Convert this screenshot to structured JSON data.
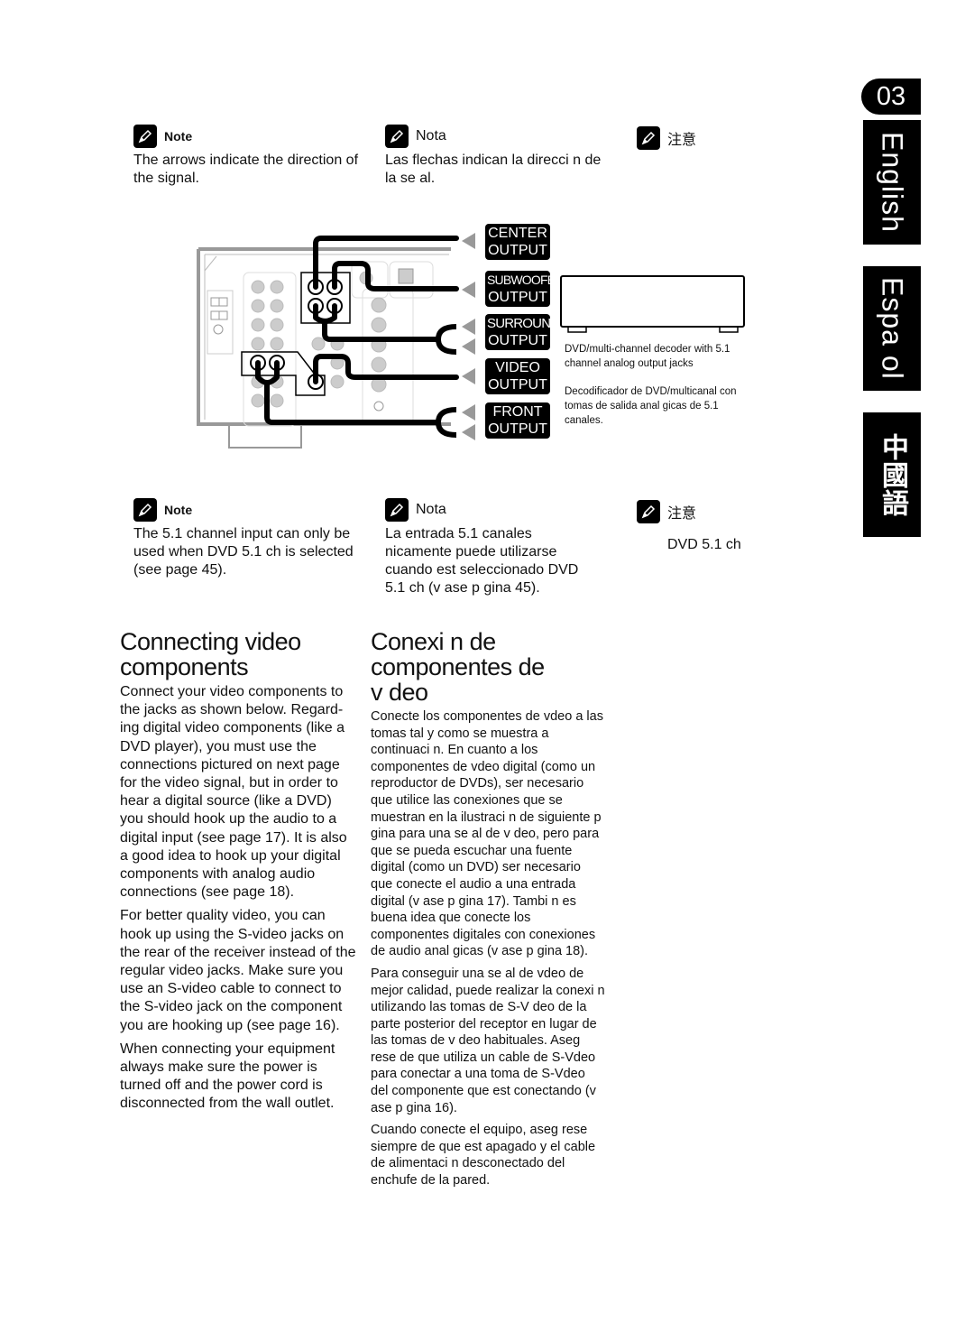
{
  "chapter": "03",
  "language_tabs": [
    {
      "label": "English"
    },
    {
      "label": "Espa ol"
    },
    {
      "label": "中國語"
    }
  ],
  "note_top": {
    "en": {
      "title": "Note",
      "text": "The arrows indicate the direction of the signal."
    },
    "es": {
      "title": "Nota",
      "text": "Las flechas indican la direcci n de la se al."
    },
    "zh": {
      "title": "注意",
      "text": ""
    }
  },
  "diagram": {
    "outputs": [
      {
        "line1": "CENTER",
        "line2": "OUTPUT"
      },
      {
        "line1": "SUBWOOFER",
        "line2": "OUTPUT"
      },
      {
        "line1": "SURROUND",
        "line2": "OUTPUT"
      },
      {
        "line1": "VIDEO",
        "line2": "OUTPUT"
      },
      {
        "line1": "FRONT",
        "line2": "OUTPUT"
      }
    ],
    "device_caption_en": "DVD/multi-channel decoder with 5.1 channel analog output jacks",
    "device_caption_es": "Decodificador de DVD/multicanal con tomas de salida anal   gicas de 5.1 canales."
  },
  "note_bottom": {
    "en": {
      "title": "Note",
      "text": "The 5.1 channel input can only be used when DVD 5.1 ch is selected (see page 45)."
    },
    "es": {
      "title": "Nota",
      "text": "La entrada 5.1 canales  nicamente puede utilizarse cuando est   seleccionado DVD 5.1 ch (v ase p gina 45)."
    },
    "zh": {
      "title": "注意",
      "text": "DVD 5.1 ch"
    }
  },
  "section_en": {
    "heading": "Connecting video components",
    "paragraphs": [
      "Connect your video components to the jacks as shown below. Regard-ing digital video components (like a DVD player), you must use the connections pictured on next page for the video signal, but in order to hear a digital source (like a DVD) you should hook up the audio to a digital input (see page 17). It is also a good idea to hook up your digital components with analog audio connections (see page 18).",
      "For better quality video, you can hook up using the S-video jacks on the rear of the receiver instead of the regular video jacks. Make sure you use an S-video cable to connect to the S-video jack on the component you are hooking up (see page 16).",
      "When connecting your equipment always make sure the power is turned off and the power cord is disconnected from the wall outlet."
    ]
  },
  "section_es": {
    "heading": "Conexi    n de componentes de v deo",
    "paragraphs": [
      "Conecte los componentes de vdeo a las tomas tal y como se muestra a continuaci  n. En cuanto a los componentes de vdeo digital (como un reproductor de DVDs), ser necesario que utilice las conexiones que se muestran en la ilustraci  n de siguiente p  gina para una se  al de v deo, pero para que se pueda escuchar una fuente digital (como un DVD) ser  necesario que conecte el audio a una entrada digital (v ase p  gina 17). Tambi n es buena idea que conecte los componentes digitales con conexiones de audio anal  gicas (v  ase p gina 18).",
      "Para conseguir una se al de vdeo de mejor calidad, puede realizar la conexi  n utilizando las tomas de S-V deo de la parte posterior del receptor en lugar de las tomas de v deo habituales. Aseg rese de que utiliza un cable de S-Vdeo para conectar a una toma de S-Vdeo del componente que est  conectando (v  ase p gina 16).",
      "Cuando conecte el equipo, aseg  rese siempre de que est apagado y el cable de alimentaci n desconectado del enchufe de la pared."
    ]
  }
}
